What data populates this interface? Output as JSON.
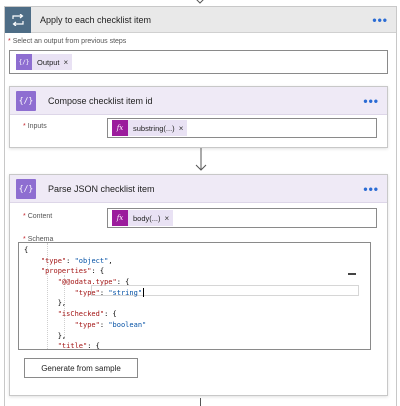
{
  "loop": {
    "title": "Apply to each checklist item",
    "more_label": "•••",
    "select_label": "Select an output from previous steps",
    "required_mark": "*",
    "output_token": {
      "label": "Output",
      "remove": "×"
    }
  },
  "compose": {
    "title": "Compose checklist item id",
    "icon_text": "{∕}",
    "more_label": "•••",
    "inputs_label": "Inputs",
    "required_mark": "*",
    "token": {
      "icon": "fx",
      "label": "substring(...)",
      "remove": "×"
    }
  },
  "parse": {
    "title": "Parse JSON checklist item",
    "icon_text": "{∕}",
    "more_label": "•••",
    "content_label": "Content",
    "schema_label": "Schema",
    "required_mark": "*",
    "token": {
      "icon": "fx",
      "label": "body(...)",
      "remove": "×"
    },
    "schema_lines": [
      "{",
      "    \"type\": \"object\",",
      "    \"properties\": {",
      "        \"@@odata.type\": {",
      "            \"type\": \"string\"",
      "        },",
      "        \"isChecked\": {",
      "            \"type\": \"boolean\"",
      "        },",
      "        \"title\": {"
    ],
    "generate_label": "Generate from sample"
  },
  "colors": {
    "accent_blue": "#2b6cd4",
    "purple_icon": "#8e6ed1",
    "loop_icon": "#4e6d86",
    "fx_token": "#9b1c9c"
  }
}
